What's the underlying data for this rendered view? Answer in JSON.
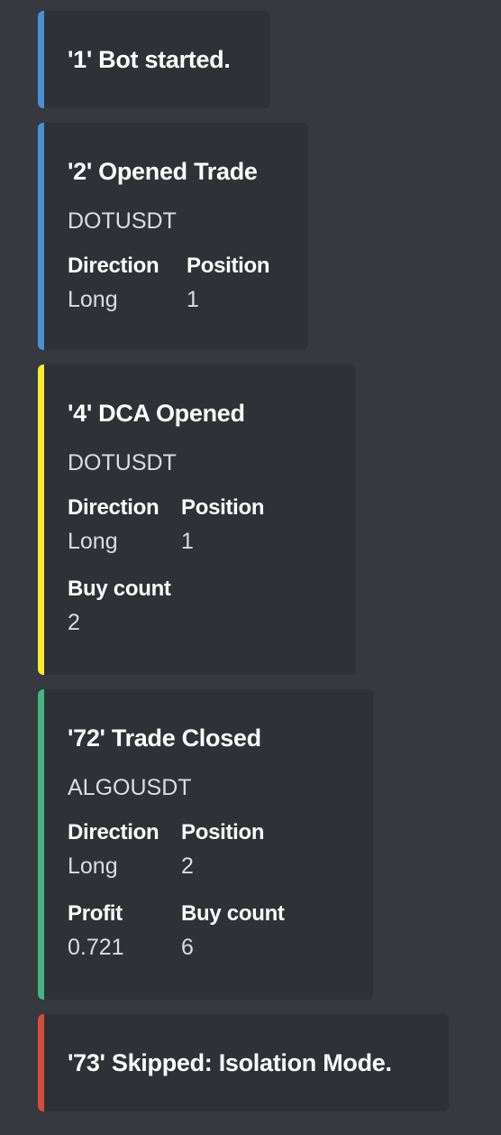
{
  "colors": {
    "background": "#36393f",
    "embed_background": "#2f3136",
    "blue": "#4a90d9",
    "yellow": "#fcec30",
    "green": "#43b581",
    "red": "#d44e3b"
  },
  "messages": [
    {
      "color": "blue",
      "title": "'1' Bot started."
    },
    {
      "color": "blue",
      "title": "'2' Opened Trade",
      "description": "DOTUSDT",
      "fields": [
        {
          "name": "Direction",
          "value": "Long"
        },
        {
          "name": "Position",
          "value": "1"
        }
      ]
    },
    {
      "color": "yellow",
      "title": "'4' DCA Opened",
      "description": "DOTUSDT",
      "fields": [
        {
          "name": "Direction",
          "value": "Long"
        },
        {
          "name": "Position",
          "value": "1"
        },
        {
          "name": "Buy count",
          "value": "2"
        }
      ]
    },
    {
      "color": "green",
      "title": "'72' Trade Closed",
      "description": "ALGOUSDT",
      "fields": [
        {
          "name": "Direction",
          "value": "Long"
        },
        {
          "name": "Position",
          "value": "2"
        },
        {
          "name": "Profit",
          "value": "0.721"
        },
        {
          "name": "Buy count",
          "value": "6"
        }
      ]
    },
    {
      "color": "red",
      "title": "'73' Skipped: Isolation Mode."
    }
  ]
}
